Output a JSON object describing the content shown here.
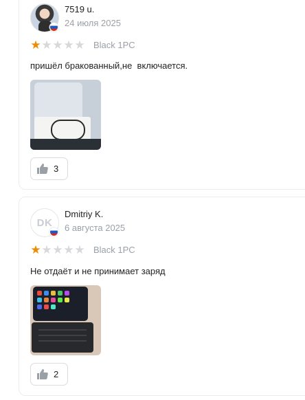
{
  "reviews": [
    {
      "author": "7519 u.",
      "date": "24 июля 2025",
      "rating": 1,
      "max_rating": 5,
      "variant": "Black 1PC",
      "text": "пришёл бракованный,не  включается.",
      "likes": "3",
      "country_flag": "russia-flag-icon",
      "avatar": "user-photo"
    },
    {
      "author": "Dmitriy K.",
      "avatar_initials": "DK",
      "date": "6 августа 2025",
      "rating": 1,
      "max_rating": 5,
      "variant": "Black 1PC",
      "text": "Не отдаёт и не принимает заряд",
      "likes": "2",
      "country_flag": "russia-flag-icon"
    }
  ],
  "colors": {
    "star_active": "#f08a00",
    "star_inactive": "#d6d8db",
    "muted_text": "#9ba0a6",
    "border": "#ececec"
  },
  "icons": {
    "like": "thumbs-up-icon",
    "star": "star-icon"
  }
}
